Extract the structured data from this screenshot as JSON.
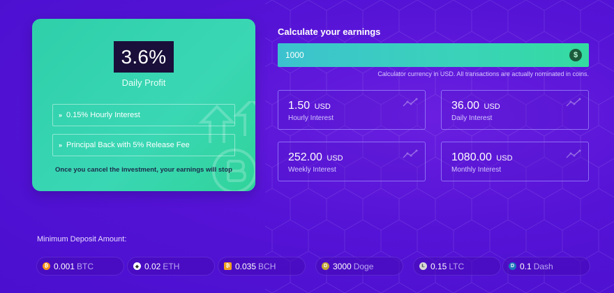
{
  "plan": {
    "rate": "3.6%",
    "rate_label": "Daily Profit",
    "features": [
      "0.15% Hourly Interest",
      "Principal Back with 5% Release Fee"
    ],
    "note": "Once you cancel the investment, your earnings will stop"
  },
  "calculator": {
    "title": "Calculate your earnings",
    "amount": "1000",
    "currency_icon": "dollar-icon",
    "note": "Calculator currency in USD. All transactions are actually nominated in coins.",
    "results": [
      {
        "amount": "1.50",
        "currency": "USD",
        "label": "Hourly Interest"
      },
      {
        "amount": "36.00",
        "currency": "USD",
        "label": "Daily Interest"
      },
      {
        "amount": "252.00",
        "currency": "USD",
        "label": "Weekly Interest"
      },
      {
        "amount": "1080.00",
        "currency": "USD",
        "label": "Monthly Interest"
      }
    ]
  },
  "deposit": {
    "title": "Minimum Deposit Amount:",
    "coins": [
      {
        "amount": "0.001",
        "symbol": "BTC",
        "color": "#f7931a",
        "glyph": "₿"
      },
      {
        "amount": "0.02",
        "symbol": "ETH",
        "color": "#ffffff",
        "glyph": "◆"
      },
      {
        "amount": "0.035",
        "symbol": "BCH",
        "color": "#f0a020",
        "glyph": "₿"
      },
      {
        "amount": "3000",
        "symbol": "Doge",
        "color": "#c2a633",
        "glyph": "D"
      },
      {
        "amount": "0.15",
        "symbol": "LTC",
        "color": "#d8d8d8",
        "glyph": "Ł"
      },
      {
        "amount": "0.1",
        "symbol": "Dash",
        "color": "#1c75bc",
        "glyph": "D"
      }
    ]
  },
  "colors": {
    "background": "#5513d6",
    "plan_card": "#35d4ae",
    "rate_box": "#1a0f3a",
    "accent_green": "#34dba0"
  }
}
